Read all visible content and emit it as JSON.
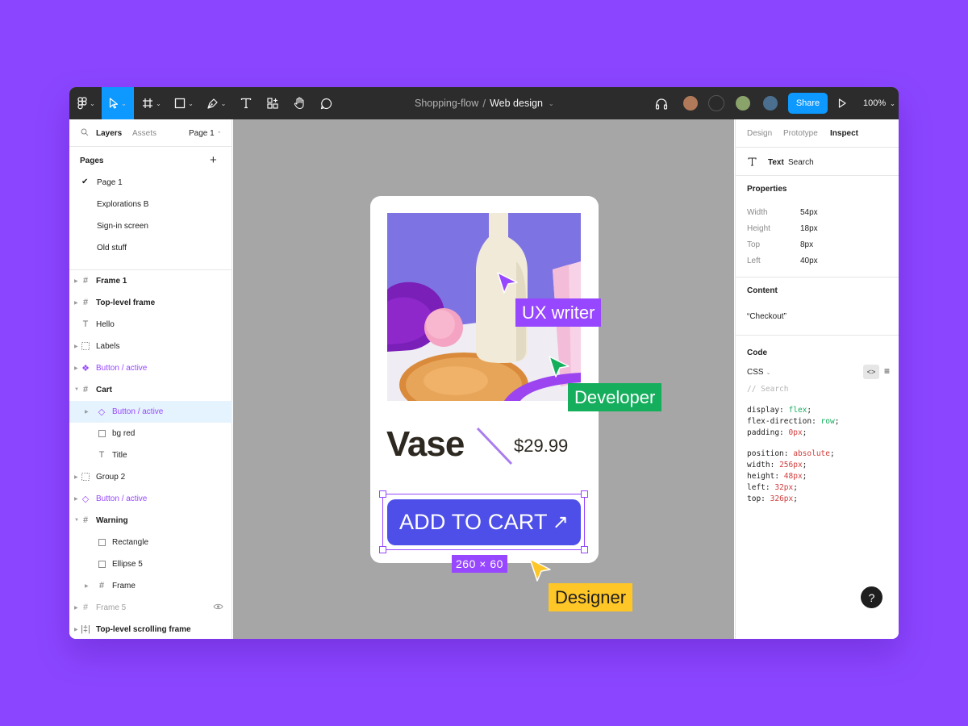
{
  "toolbar": {
    "file_project": "Shopping-flow",
    "file_separator": "/",
    "file_name": "Web design",
    "share_label": "Share",
    "zoom_label": "100%",
    "tools": [
      "figma-menu-icon",
      "move-tool-icon",
      "frame-tool-icon",
      "shape-tool-icon",
      "pen-tool-icon",
      "text-tool-icon",
      "resources-icon",
      "hand-tool-icon",
      "comment-icon"
    ],
    "avatar_colors": [
      "#b07a5a",
      "#2a2a2a",
      "#8aa36b",
      "#4b6f8f"
    ]
  },
  "left_panel": {
    "tabs": {
      "layers": "Layers",
      "assets": "Assets",
      "page": "Page 1"
    },
    "pages_heading": "Pages",
    "pages": [
      "Page 1",
      "Explorations B",
      "Sign-in screen",
      "Old stuff"
    ],
    "layers": [
      {
        "label": "Frame 1",
        "icon": "frame-icon"
      },
      {
        "label": "Top-level frame",
        "icon": "frame-icon"
      },
      {
        "label": "Hello",
        "icon": "text-icon"
      },
      {
        "label": "Labels",
        "icon": "group-icon"
      },
      {
        "label": "Button / active",
        "icon": "component-icon"
      },
      {
        "label": "Cart",
        "icon": "frame-icon"
      },
      {
        "label": "Button / active",
        "icon": "instance-icon"
      },
      {
        "label": "bg red",
        "icon": "rectangle-icon"
      },
      {
        "label": "Title",
        "icon": "text-icon"
      },
      {
        "label": "Group 2",
        "icon": "group-icon"
      },
      {
        "label": "Button / active",
        "icon": "instance-icon"
      },
      {
        "label": "Warning",
        "icon": "frame-icon"
      },
      {
        "label": "Rectangle",
        "icon": "rectangle-icon"
      },
      {
        "label": "Ellipse 5",
        "icon": "rectangle-icon"
      },
      {
        "label": "Frame",
        "icon": "frame-icon"
      },
      {
        "label": "Frame 5",
        "icon": "frame-icon"
      },
      {
        "label": "Top-level scrolling frame",
        "icon": "scroll-frame-icon"
      }
    ]
  },
  "canvas": {
    "product_title": "Vase",
    "product_price": "$29.99",
    "cart_button_label": "ADD TO CART",
    "cart_button_arrow": "↗",
    "dimensions_label": "260 × 60",
    "collaborators": [
      {
        "label": "UX writer",
        "color": "#9747ff"
      },
      {
        "label": "Developer",
        "color": "#14ae5c"
      },
      {
        "label": "Designer",
        "color": "#ffc627"
      }
    ],
    "button_color": "#4d4fe8"
  },
  "right_panel": {
    "tabs": {
      "design": "Design",
      "prototype": "Prototype",
      "inspect": "Inspect"
    },
    "layer_type": "Text",
    "layer_name": "Search",
    "properties_heading": "Properties",
    "properties": [
      {
        "label": "Width",
        "value": "54px"
      },
      {
        "label": "Height",
        "value": "18px"
      },
      {
        "label": "Top",
        "value": "8px"
      },
      {
        "label": "Left",
        "value": "40px"
      }
    ],
    "content_heading": "Content",
    "content_value": "“Checkout”",
    "code_heading": "Code",
    "code_language": "CSS",
    "code_comment": "// Search",
    "code_lines": [
      {
        "prop": "display",
        "value": "flex",
        "kind": "g"
      },
      {
        "prop": "flex-direction",
        "value": "row",
        "kind": "g"
      },
      {
        "prop": "padding",
        "value": "0px",
        "kind": "r"
      },
      {
        "prop": "position",
        "value": "absolute",
        "kind": "r"
      },
      {
        "prop": "width",
        "value": "256px",
        "kind": "r"
      },
      {
        "prop": "height",
        "value": "48px",
        "kind": "r"
      },
      {
        "prop": "left",
        "value": "32px",
        "kind": "r"
      },
      {
        "prop": "top",
        "value": "326px",
        "kind": "r"
      }
    ],
    "help_label": "?"
  }
}
